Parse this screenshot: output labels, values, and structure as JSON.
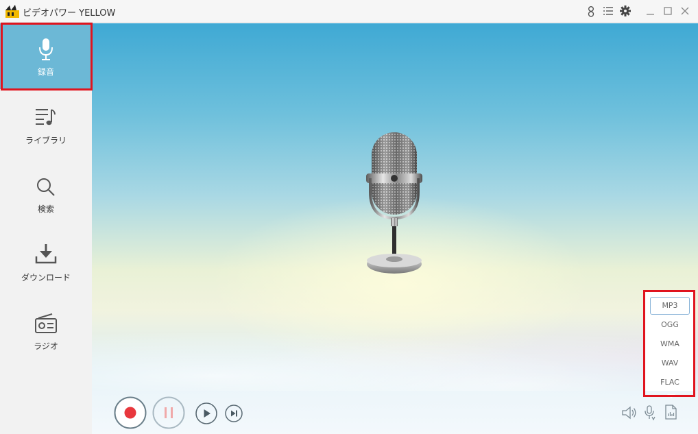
{
  "window": {
    "title": "ビデオパワー YELLOW"
  },
  "titlebar_icons": [
    "user-icon",
    "list-menu-icon",
    "gear-icon",
    "minimize-icon",
    "maximize-icon",
    "close-icon"
  ],
  "sidebar": {
    "items": [
      {
        "id": "record",
        "label": "録音",
        "icon": "microphone-icon",
        "active": true
      },
      {
        "id": "library",
        "label": "ライブラリ",
        "icon": "music-list-icon",
        "active": false
      },
      {
        "id": "search",
        "label": "検索",
        "icon": "search-icon",
        "active": false
      },
      {
        "id": "download",
        "label": "ダウンロード",
        "icon": "download-icon",
        "active": false
      },
      {
        "id": "radio",
        "label": "ラジオ",
        "icon": "radio-icon",
        "active": false
      }
    ]
  },
  "main": {
    "center_graphic": "vintage-microphone-image"
  },
  "controls": {
    "record_button": "record-icon",
    "pause_button": "pause-icon",
    "play_button": "play-icon",
    "next_button": "skip-next-icon",
    "volume": "speaker-icon",
    "mic_source": "microphone-source-icon",
    "format": "audio-file-icon"
  },
  "format_menu": {
    "options": [
      "MP3",
      "OGG",
      "WMA",
      "WAV",
      "FLAC"
    ],
    "selected": "MP3"
  },
  "colors": {
    "sidebar_active": "#6cb8d6",
    "highlight_box": "#e0141e",
    "record_red": "#e8373d",
    "pause_pink": "#f0a9a9"
  }
}
